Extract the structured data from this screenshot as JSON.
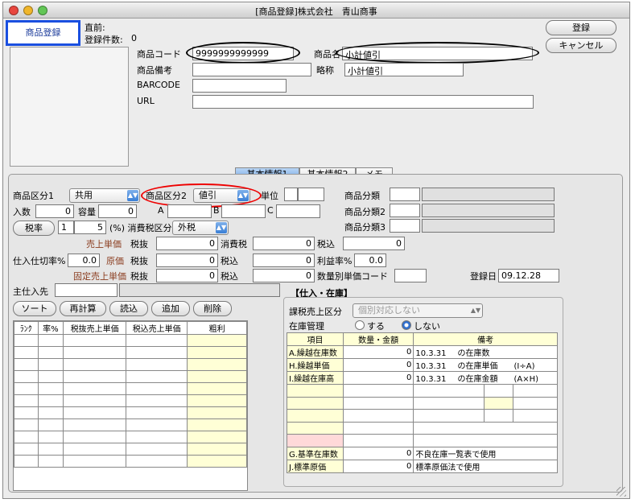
{
  "window": {
    "title": "[商品登録]株式会社　青山商事"
  },
  "header": {
    "mode_button": "商品登録",
    "prev_label": "直前:",
    "count_label": "登録件数:",
    "count_value": "0",
    "register_button": "登録",
    "cancel_button": "キャンセル"
  },
  "product": {
    "code_label": "商品コード",
    "code_value": "9999999999999",
    "name_label": "商品名",
    "name_value": "小計値引",
    "note_label": "商品備考",
    "note_value": "",
    "short_label": "略称",
    "short_value": "小計値引",
    "barcode_label": "BARCODE",
    "barcode_value": "",
    "url_label": "URL",
    "url_value": ""
  },
  "tabs": [
    "基本情報1",
    "基本情報2",
    "メモ"
  ],
  "basic": {
    "kubun1_label": "商品区分1",
    "kubun1_value": "共用",
    "kubun2_label": "商品区分2",
    "kubun2_value": "値引",
    "unit_label": "単位",
    "bunrui1_label": "商品分類",
    "bunrui2_label": "商品分類2",
    "bunrui3_label": "商品分類3",
    "irisu_label": "入数",
    "irisu_value": "0",
    "youryou_label": "容量",
    "youryou_value": "0",
    "a_label": "A",
    "b_label": "B",
    "c_label": "C",
    "tax_rate_button": "税率",
    "tax_rate_code": "1",
    "tax_rate_value": "5",
    "tax_rate_suffix": "(%) 消費税区分",
    "tax_kubun_value": "外税",
    "sale_price_label": "売上単価",
    "tax_excl_label": "税抜",
    "consumption_label": "消費税",
    "tax_incl_label": "税込",
    "sale_excl": "0",
    "sale_tax": "0",
    "sale_incl": "0",
    "shiire_rate_label": "仕入仕切率%",
    "shiire_rate_value": "0.0",
    "genka_label": "原価",
    "genka_excl": "0",
    "genka_incl": "0",
    "margin_label": "利益率%",
    "margin_value": "0.0",
    "fixed_label": "固定売上単価",
    "fixed_excl": "0",
    "fixed_incl": "0",
    "qty_price_label": "数量別単価コード",
    "reg_date_label": "登録日",
    "reg_date_value": "09.12.28",
    "supplier_label": "主仕入先"
  },
  "price_buttons": [
    "ソート",
    "再計算",
    "読込",
    "追加",
    "削除"
  ],
  "price_table": {
    "headers": [
      "ﾗﾝｸ",
      "率%",
      "税抜売上単価",
      "税込売上単価",
      "粗利"
    ]
  },
  "inventory": {
    "section_label": "【仕入・在庫】",
    "taxable_label": "課税売上区分",
    "taxable_value": "個別対応しない",
    "stock_mgmt_label": "在庫管理",
    "radio_yes": "する",
    "radio_no": "しない",
    "headers": [
      "項目",
      "数量・金額",
      "備考"
    ],
    "rows": [
      {
        "item": "A.繰越在庫数",
        "value": "0",
        "date": "10.3.31",
        "note": "の在庫数",
        "formula": ""
      },
      {
        "item": "H.繰越単価",
        "value": "0",
        "date": "10.3.31",
        "note": "の在庫単価",
        "formula": "(I÷A)"
      },
      {
        "item": "I.繰越在庫高",
        "value": "0",
        "date": "10.3.31",
        "note": "の在庫金額",
        "formula": "(A×H)"
      }
    ],
    "g_label": "G.基準在庫数",
    "g_value": "0",
    "g_note": "不良在庫一覧表で使用",
    "j_label": "J.標準原価",
    "j_value": "0",
    "j_note": "標準原価法で使用"
  }
}
